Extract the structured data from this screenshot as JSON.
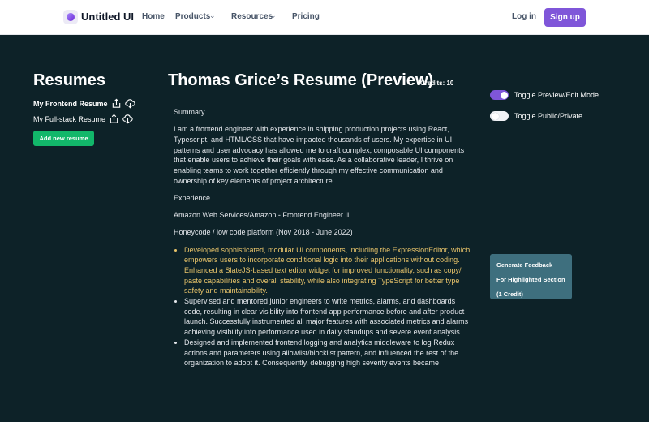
{
  "header": {
    "brand": "Untitled UI",
    "nav": [
      {
        "label": "Home"
      },
      {
        "label": "Products"
      },
      {
        "label": "Resources"
      },
      {
        "label": "Pricing"
      }
    ],
    "login_label": "Log in",
    "signup_label": "Sign up"
  },
  "sidebar": {
    "title": "Resumes",
    "resumes": [
      {
        "name": "My Frontend Resume",
        "active": true
      },
      {
        "name": "My Full-stack Resume",
        "active": false
      }
    ],
    "add_label": "Add new resume"
  },
  "main": {
    "title": "Thomas Grice’s Resume (Preview)",
    "credits": "Credits: 10",
    "summary_heading": "Summary",
    "summary": "I am a frontend engineer with experience in shipping production projects using React, Typescript, and HTML/CSS that have impacted thousands of users. My expertise in UI patterns and user advocacy has allowed me to craft complex, composable UI components that enable users to achieve their goals with ease. As a collaborative leader, I thrive on enabling teams to work together efficiently through my effective communication and ownership of key elements of project architecture.",
    "experience_heading": "Experience",
    "job_title": "Amazon Web Services/Amazon - Frontend Engineer II",
    "job_team": "Honeycode / low code platform (Nov 2018 - June 2022)",
    "bullets": [
      "Developed sophisticated, modular UI components, including the ExpressionEditor, which empowers users to incorporate conditional logic into their applications without coding. Enhanced a SlateJS-based text editor widget for improved functionality, such as copy/ paste capabilities and overall stability, while also integrating TypeScript for better type safety and maintainability.",
      "Supervised and mentored junior engineers to write metrics, alarms, and dashboards code, resulting in clear visibility into frontend app performance before and after product launch. Successfully instrumented all major features with associated metrics and alarms achieving visibility into performance used in daily standups and severe event analysis",
      "Designed and implemented frontend logging and analytics middleware to log Redux actions and parameters using allowlist/blocklist pattern, and influenced the rest of the organization to adopt it. Consequently, debugging high severity events became"
    ]
  },
  "toggles": {
    "preview_edit": {
      "label": "Toggle Preview/Edit Mode",
      "on": true
    },
    "public_private": {
      "label": "Toggle Public/Private",
      "on": false
    }
  },
  "feedback": {
    "line1": "Generate Feedback",
    "line2": "For Highlighted Section",
    "line3": "(1 Credit)"
  },
  "colors": {
    "background": "#0d2228",
    "accent": "#7f56d9",
    "add_button": "#12b76a",
    "highlight_text": "#e9c46a",
    "feedback_button": "#3e6f7e"
  }
}
